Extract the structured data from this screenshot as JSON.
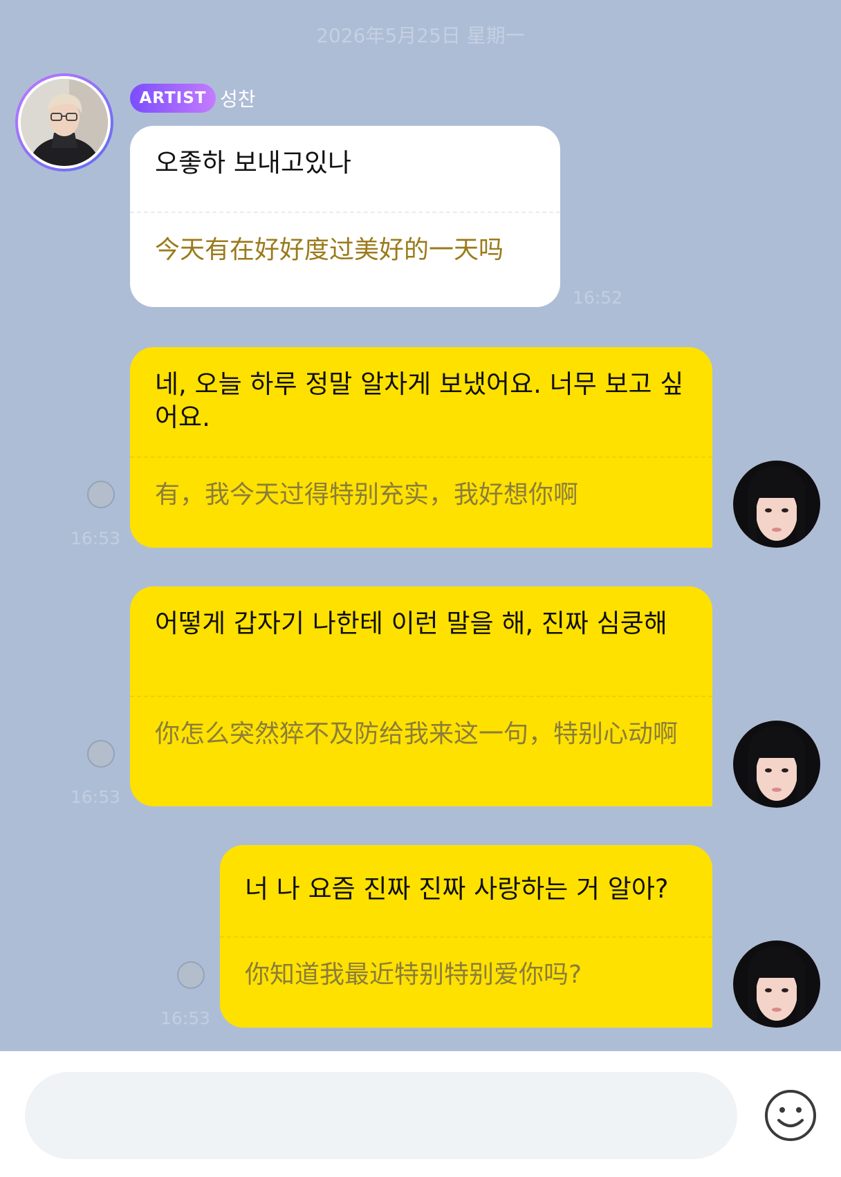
{
  "date_label": "2026年5月25日 星期一",
  "artist": {
    "badge": "ARTIST",
    "name": "성찬"
  },
  "messages": [
    {
      "sender": "artist",
      "original": "오좋하 보내고있나",
      "translation": "今天有在好好度过美好的一天吗",
      "time": "16:52"
    },
    {
      "sender": "me",
      "original": "네, 오늘 하루 정말 알차게 보냈어요. 너무 보고 싶어요.",
      "translation": "有，我今天过得特别充实，我好想你啊",
      "time": "16:53"
    },
    {
      "sender": "me",
      "original": "어떻게 갑자기 나한테 이런 말을 해, 진짜 심쿵해",
      "translation": "你怎么突然猝不及防给我来这一句，特别心动啊",
      "time": "16:53"
    },
    {
      "sender": "me",
      "original": "너 나 요즘 진짜 진짜 사랑하는 거 알아?",
      "translation": "你知道我最近特别特别爱你吗?",
      "time": "16:53"
    }
  ],
  "input": {
    "placeholder": "",
    "value": ""
  },
  "icons": {
    "emoji": "smiley-face-icon"
  },
  "colors": {
    "background": "#aebdd6",
    "my_bubble": "#ffe100",
    "artist_bubble": "#ffffff",
    "badge_start": "#7b4dff",
    "badge_end": "#c47cff",
    "translation_artist": "#9a7a1a",
    "translation_me": "#8b7d3a"
  }
}
